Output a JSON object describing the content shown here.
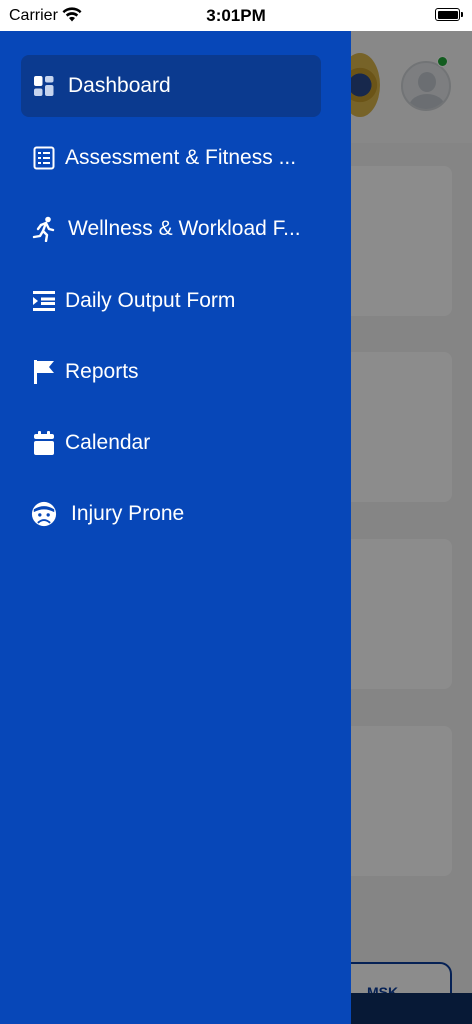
{
  "status_bar": {
    "carrier": "Carrier",
    "time": "3:01PM",
    "wifi_icon": "wifi-icon",
    "battery_icon": "battery-full-icon"
  },
  "drawer": {
    "active_item": "dashboard",
    "items": [
      {
        "id": "dashboard",
        "label": "Dashboard",
        "icon": "dashboard-grid-icon"
      },
      {
        "id": "assessment",
        "label": "Assessment & Fitness ...",
        "icon": "clipboard-list-icon"
      },
      {
        "id": "wellness",
        "label": "Wellness & Workload F...",
        "icon": "running-person-icon"
      },
      {
        "id": "daily-output",
        "label": "Daily Output Form",
        "icon": "indent-list-icon"
      },
      {
        "id": "reports",
        "label": "Reports",
        "icon": "flag-icon"
      },
      {
        "id": "calendar",
        "label": "Calendar",
        "icon": "calendar-icon"
      },
      {
        "id": "injury-prone",
        "label": "Injury Prone",
        "icon": "injured-face-icon"
      }
    ]
  },
  "background": {
    "bottom_button_label": "MSK",
    "colors": {
      "drawer": "#0747b8",
      "active_item": "#0b3a8f",
      "online": "#22a83a"
    }
  }
}
